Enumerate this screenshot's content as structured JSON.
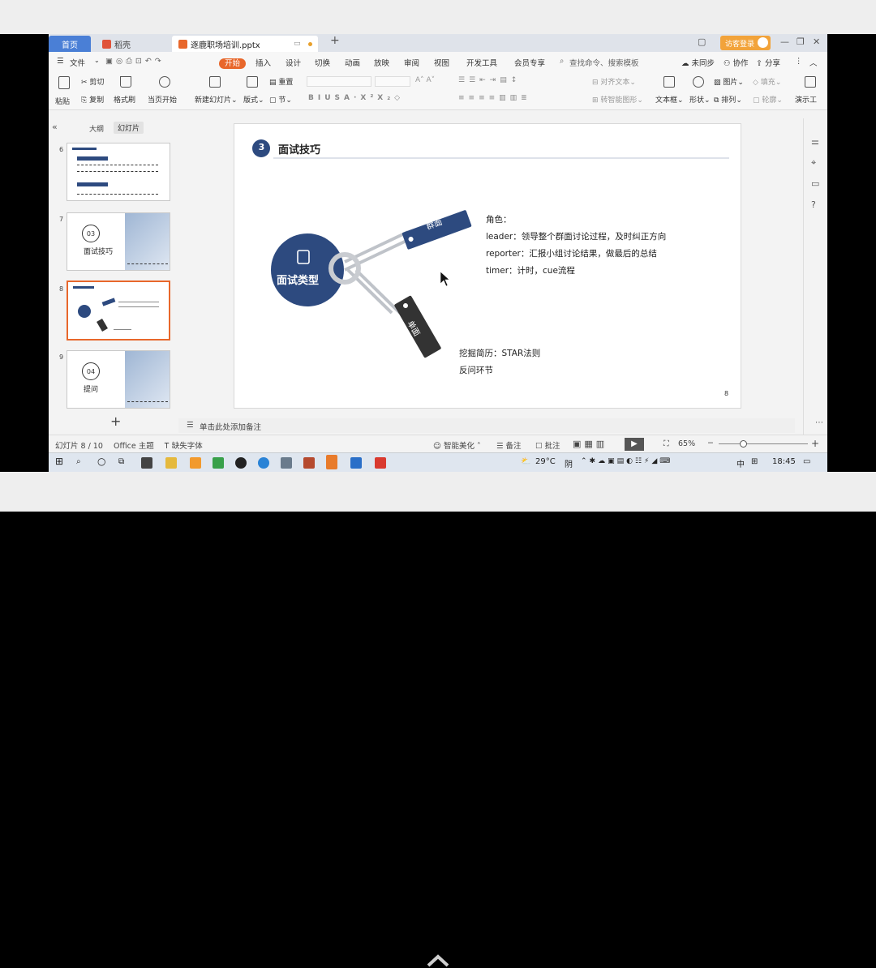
{
  "tabs": {
    "home": "首页",
    "daoke": "稻壳",
    "document": "逐鹿职场培训.pptx",
    "login": "访客登录"
  },
  "menu": {
    "file": "文件",
    "items": [
      "开始",
      "插入",
      "设计",
      "切换",
      "动画",
      "放映",
      "审阅",
      "视图",
      "开发工具",
      "会员专享"
    ],
    "search_placeholder": "查找命令、搜索模板",
    "sync": "未同步",
    "collab": "协作",
    "share": "分享"
  },
  "ribbon": {
    "paste": "粘贴",
    "cut": "剪切",
    "copy": "复制",
    "format_painter": "格式刷",
    "from_current": "当页开始",
    "new_slide": "新建幻灯片",
    "layout": "版式",
    "section": "节",
    "reset": "重置",
    "align_text": "对齐文本",
    "smart_shape": "转智能图形",
    "textbox": "文本框",
    "shape": "形状",
    "picture": "图片",
    "arrange": "排列",
    "fill": "填充",
    "outline": "轮廓",
    "presenter": "演示工"
  },
  "leftpane": {
    "tab_outline": "大纲",
    "tab_slides": "幻灯片",
    "thumb_numbers": [
      "6",
      "7",
      "8",
      "9"
    ],
    "thumb7": {
      "num": "03",
      "title": "面试技巧"
    },
    "thumb9": {
      "num": "04",
      "title": "提问"
    }
  },
  "slide": {
    "section_number": "3",
    "section_title": "面试技巧",
    "center_label": "面试类型",
    "tag1": "群面",
    "tag2": "单面",
    "role_heading": "角色：",
    "role_lines": [
      "leader：领导整个群面讨论过程，及时纠正方向",
      "reporter：汇报小组讨论结果，做最后的总结",
      "timer：计时，cue流程"
    ],
    "single_lines": [
      "挖掘简历：STAR法则",
      "反问环节"
    ],
    "page_number": "8"
  },
  "notes_placeholder": "单击此处添加备注",
  "status": {
    "slide_index": "幻灯片 8 / 10",
    "theme": "Office 主题",
    "missing_font": "缺失字体",
    "beautify": "智能美化",
    "notes": "备注",
    "comments": "批注",
    "zoom": "65%"
  },
  "taskbar": {
    "temperature": "29°C",
    "weather": "阴",
    "ime": "中",
    "time": "18:45"
  },
  "colors": {
    "accent": "#e8672b",
    "navy": "#2d4a7f",
    "tab_blue": "#4a7fd6"
  }
}
